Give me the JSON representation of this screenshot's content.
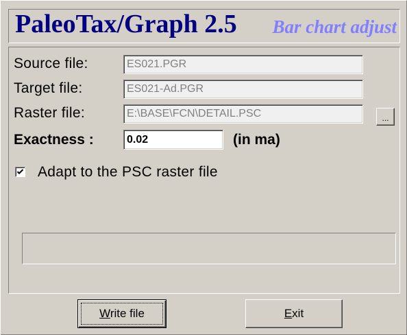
{
  "window": {
    "app_title": "PaleoTax/Graph 2.5",
    "subtitle": "Bar chart adjust"
  },
  "form": {
    "source_file": {
      "label": "Source file:",
      "value": "ES021.PGR",
      "enabled": false
    },
    "target_file": {
      "label": "Target file:",
      "value": "ES021-Ad.PGR",
      "enabled": false
    },
    "raster_file": {
      "label": "Raster file:",
      "value": "E:\\BASE\\FCN\\DETAIL.PSC",
      "enabled": false,
      "browse_label": "..."
    },
    "exactness": {
      "label": "Exactness :",
      "value": "0.02",
      "unit": "(in ma)",
      "enabled": true
    },
    "adapt_to_raster": {
      "label": "Adapt to the PSC raster file",
      "checked": true,
      "icon": "check-icon"
    }
  },
  "progress": {
    "fraction": 0
  },
  "buttons": {
    "write_file": {
      "label": "Write file",
      "default": true,
      "focused": true
    },
    "exit": {
      "label": "Exit"
    }
  },
  "colors": {
    "title": "#000080",
    "subtitle": "#8080ff",
    "face": "#d4d0c8",
    "disabled_text": "#808080"
  }
}
